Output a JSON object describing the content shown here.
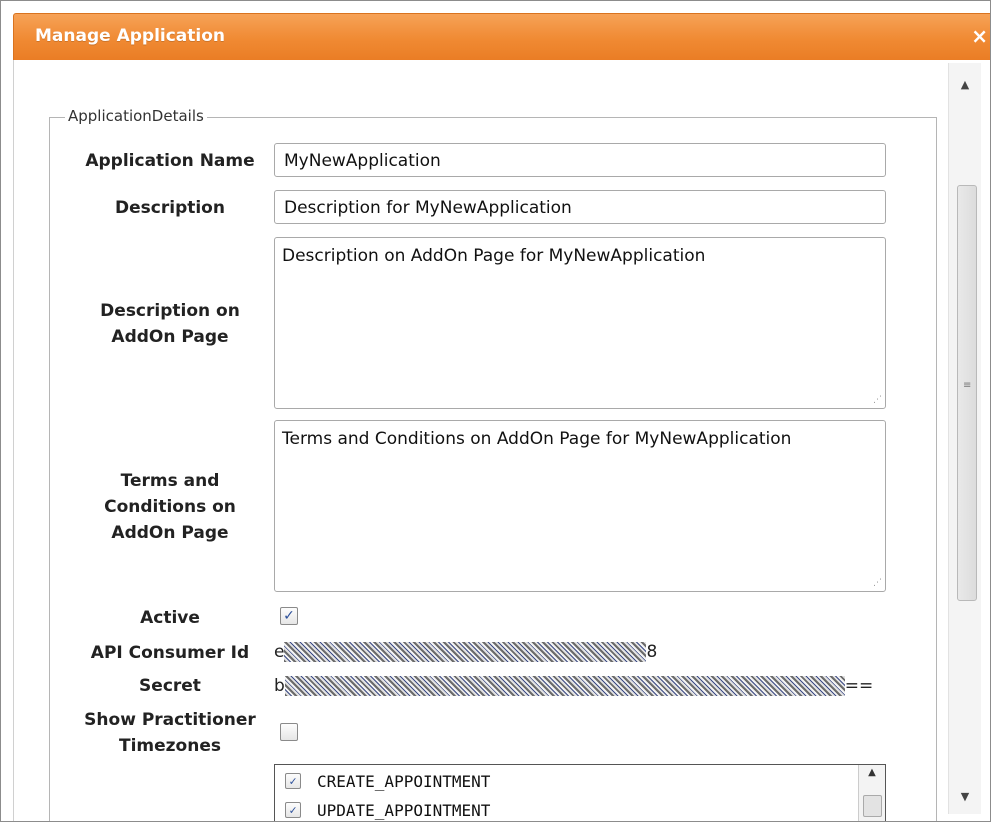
{
  "dialog": {
    "title": "Manage Application",
    "close_glyph": "×"
  },
  "fieldset": {
    "legend": "ApplicationDetails"
  },
  "fields": {
    "application_name": {
      "label": "Application Name",
      "value": "MyNewApplication"
    },
    "description": {
      "label": "Description",
      "value": "Description for MyNewApplication"
    },
    "description_addon": {
      "label_line1": "Description on",
      "label_line2": "AddOn Page",
      "value": "Description on AddOn Page for MyNewApplication"
    },
    "terms_addon": {
      "label_line1": "Terms and",
      "label_line2": "Conditions on",
      "label_line3": "AddOn Page",
      "value": "Terms and Conditions on AddOn Page for MyNewApplication"
    },
    "active": {
      "label": "Active",
      "checked": true,
      "check_glyph": "✓"
    },
    "api_consumer_id": {
      "label": "API Consumer Id",
      "value_prefix": "e",
      "value_suffix": "8"
    },
    "secret": {
      "label": "Secret",
      "value_prefix": "b",
      "value_suffix": "=="
    },
    "show_practitioner_timezones": {
      "label_line1": "Show Practitioner",
      "label_line2": "Timezones",
      "checked": false
    }
  },
  "permissions": {
    "items": [
      {
        "label": "CREATE_APPOINTMENT",
        "checked": true
      },
      {
        "label": "UPDATE_APPOINTMENT",
        "checked": true
      }
    ]
  },
  "icons": {
    "scroll_up": "▲",
    "scroll_down": "▼",
    "grip": "≡",
    "resize": "⋰"
  },
  "colors": {
    "titlebar": "#f08a33",
    "checkmark": "#2b4f9a"
  }
}
